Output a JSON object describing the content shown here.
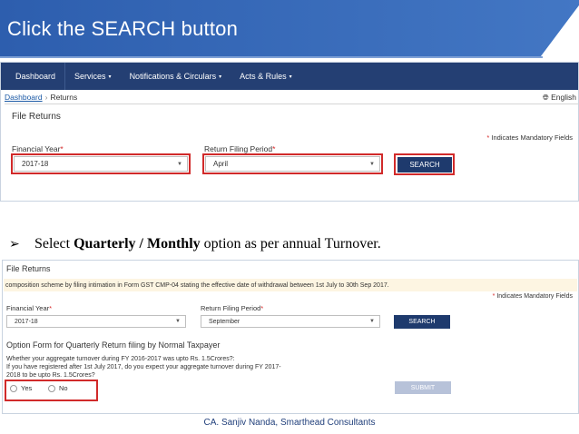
{
  "slide": {
    "title": "Click the SEARCH button",
    "bullet_prefix": "Select ",
    "bullet_bold": "Quarterly / Monthly",
    "bullet_suffix": " option as per annual Turnover.",
    "footer": "CA. Sanjiv Nanda, Smarthead Consultants",
    "colors": {
      "banner": "#2a5aa8",
      "nav": "#243f73",
      "highlight": "#d12a2a",
      "button": "#1e3a6d"
    }
  },
  "screen1": {
    "nav": [
      {
        "label": "Dashboard",
        "caret": ""
      },
      {
        "label": "Services",
        "caret": "▾"
      },
      {
        "label": "Notifications & Circulars",
        "caret": "▾"
      },
      {
        "label": "Acts & Rules",
        "caret": "▾"
      }
    ],
    "breadcrumb": {
      "home": "Dashboard",
      "current": "Returns"
    },
    "language": "English",
    "panel_title": "File Returns",
    "mandatory_note": "Indicates Mandatory Fields",
    "fy_label": "Financial Year",
    "fy_value": "2017-18",
    "period_label": "Return Filing Period",
    "period_value": "April",
    "search_label": "SEARCH"
  },
  "screen2": {
    "panel_title": "File Returns",
    "info_text": "composition scheme by filing intimation in Form GST CMP-04 stating the effective date of withdrawal between 1st July to 30th Sep 2017.",
    "mandatory_note": "Indicates Mandatory Fields",
    "fy_label": "Financial Year",
    "fy_value": "2017-18",
    "period_label": "Return Filing Period",
    "period_value": "September",
    "search_label": "SEARCH",
    "option_title": "Option Form for Quarterly Return filing by Normal Taxpayer",
    "question_line1": "Whether your aggregate turnover during FY 2016-2017 was upto Rs. 1.5Crores?:",
    "question_line2": "If you have registered after 1st July 2017, do you expect your aggregate turnover during FY 2017-",
    "question_line3": "2018 to be upto Rs. 1.5Crores?",
    "yes_label": "Yes",
    "no_label": "No",
    "submit_label": "SUBMIT"
  }
}
